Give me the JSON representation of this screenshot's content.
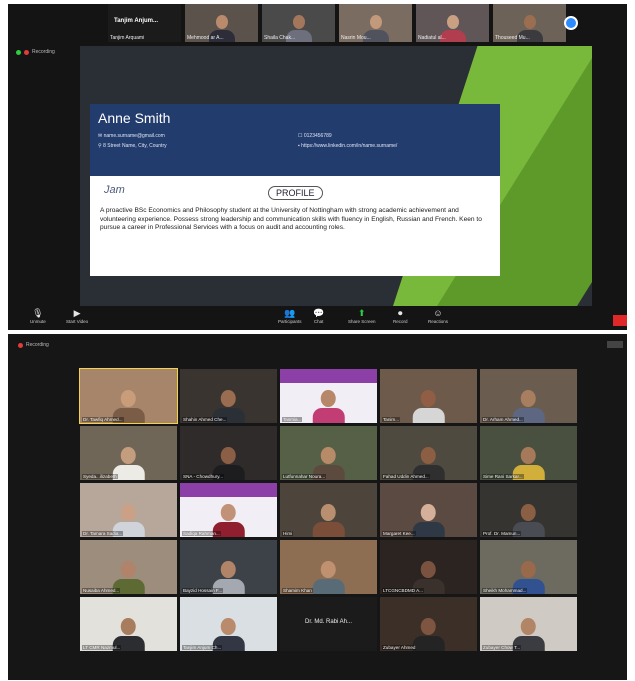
{
  "top_window": {
    "recording_label": "Recording",
    "thumbnails": [
      {
        "label": "Tanjim Arquami",
        "type": "name",
        "big": "Tanjim Anjum..."
      },
      {
        "label": "Mehmood ar A...",
        "bg": "#5b524b",
        "skin": "#b98a6c",
        "shirt": "#2d2d3a"
      },
      {
        "label": "Shaila Chak...",
        "bg": "#4a4a4a",
        "skin": "#a4775c",
        "shirt": "#6d6f7d"
      },
      {
        "label": "Nasrin Mou...",
        "bg": "#7a6c60",
        "skin": "#c29a7b",
        "shirt": "#50525e"
      },
      {
        "label": "Nadiatul al...",
        "bg": "#605658",
        "skin": "#caa083",
        "shirt": "#b13e4f"
      },
      {
        "label": "Thouseed Mu...",
        "bg": "#6c6257",
        "skin": "#9b6e52",
        "shirt": "#3b3b3f"
      }
    ],
    "shared_slide": {
      "name": "Anne Smith",
      "email": "name.surname@gmail.com",
      "address": "8 Street Name, City, Country",
      "phone": "0123456789",
      "linkedin": "https://www.linkedin.com/in/name.surname/",
      "section_heading": "PROFILE",
      "scribble": "Jam",
      "profile_text": "A proactive BSc Economics and Philosophy student at the University of Nottingham with strong academic achievement and volunteering experience. Possess strong leadership and communication skills with fluency in English, Russian and French. Keen to pursue a career in Professional Services with a focus on audit and accounting roles."
    },
    "toolbar": {
      "items": [
        {
          "icon": "microphone-icon",
          "glyph": "🎙",
          "label": "Unmute"
        },
        {
          "icon": "video-icon",
          "glyph": "▶",
          "label": "Start Video"
        },
        {
          "icon": "participants-icon",
          "glyph": "👥",
          "label": "Participants"
        },
        {
          "icon": "chat-icon",
          "glyph": "💬",
          "label": "Chat"
        },
        {
          "icon": "share-screen-icon",
          "glyph": "⬆",
          "label": "Share Screen"
        },
        {
          "icon": "record-icon",
          "glyph": "⏺",
          "label": "Record"
        },
        {
          "icon": "reactions-icon",
          "glyph": "☺",
          "label": "Reactions"
        }
      ],
      "accent": "#2d8cff",
      "end_color": "#e02828"
    }
  },
  "bottom_window": {
    "recording_label": "Recording",
    "tiles": [
      {
        "label": "Dr. Tawfiq Ahmed...",
        "bg": "#a6856a",
        "skin": "#c99c7a",
        "shirt": "#7a5c47",
        "active": true
      },
      {
        "label": "Shahin Ahmed Che...",
        "bg": "#3a3431",
        "skin": "#9a6c50",
        "shirt": "#2b2f36"
      },
      {
        "label": "Tasmia...",
        "bg": "#8c3fa6",
        "skin": "#b7876a",
        "shirt": "#c33d75",
        "slide": true
      },
      {
        "label": "Tanim...",
        "bg": "#6e5a4b",
        "skin": "#8f5e45",
        "shirt": "#d6d6d6"
      },
      {
        "label": "Dr. Arham Ahmed...",
        "bg": "#6b5c50",
        "skin": "#a77e5f",
        "shirt": "#5d6781"
      },
      {
        "label": "Syeda...ilizabeth",
        "bg": "#706658",
        "skin": "#c49d7e",
        "shirt": "#edebe6"
      },
      {
        "label": "SNA - Chowdhury...",
        "bg": "#2e2b2a",
        "skin": "#8a5f45",
        "shirt": "#1d1d20"
      },
      {
        "label": "Lutfunnahar Noura...",
        "bg": "#566046",
        "skin": "#b78a68",
        "shirt": "#5c4a3f"
      },
      {
        "label": "Fahad Uddin Ahmed...",
        "bg": "#4f4a40",
        "skin": "#8c5e43",
        "shirt": "#2f2f2f"
      },
      {
        "label": "Sime Rani Sarkar...",
        "bg": "#49503f",
        "skin": "#a6795a",
        "shirt": "#d2af3b"
      },
      {
        "label": "Dr. Tamara Sadia...",
        "bg": "#b7a69a",
        "skin": "#caa087",
        "shirt": "#d0d4da"
      },
      {
        "label": "Sadiqa Rahman...",
        "bg": "#8c3fa6",
        "skin": "#c29278",
        "shirt": "#8f1f2e",
        "slide": true
      },
      {
        "label": "Himi",
        "bg": "#4d453c",
        "skin": "#b8906f",
        "shirt": "#7b4e3a"
      },
      {
        "label": "Margaret Kee...",
        "bg": "#5b4a41",
        "skin": "#d4b09a",
        "shirt": "#2f3945"
      },
      {
        "label": "Prof. Dr. Mamun...",
        "bg": "#353430",
        "skin": "#8a5f44",
        "shirt": "#4a4c53"
      },
      {
        "label": "Nusaiba Ahmed...",
        "bg": "#9c8d7c",
        "skin": "#b0836a",
        "shirt": "#5e6a34"
      },
      {
        "label": "Bayzid Hossain F...",
        "bg": "#3d4148",
        "skin": "#b18467",
        "shirt": "#a4a8b0"
      },
      {
        "label": "Shamim Khan",
        "bg": "#8d6e53",
        "skin": "#c09170",
        "shirt": "#5a6b78"
      },
      {
        "label": "LTCGNCBDMD A...",
        "bg": "#2b2420",
        "skin": "#7a5240",
        "shirt": "#3a302c"
      },
      {
        "label": "Sheikh Mohammad...",
        "bg": "#6d6a5f",
        "skin": "#99694c",
        "shirt": "#325190"
      },
      {
        "label": "LT CMR Nazmul...",
        "bg": "#e3e1dc",
        "skin": "#a77d5e",
        "shirt": "#2c2d30"
      },
      {
        "label": "Tanjim Anjum Ch...",
        "bg": "#dadfe3",
        "skin": "#b98a6c",
        "shirt": "#333744"
      },
      {
        "label": "",
        "bg": "#1b1b1b",
        "center_text": "Dr. Md. Rabi Ah...",
        "empty": true
      },
      {
        "label": "Zubayer Ahmed",
        "bg": "#3b2f28",
        "skin": "#7e5540",
        "shirt": "#242424"
      },
      {
        "label": "Zubayer Chow T...",
        "bg": "#cfcac3",
        "skin": "#b28566",
        "shirt": "#3b3c41"
      }
    ]
  }
}
